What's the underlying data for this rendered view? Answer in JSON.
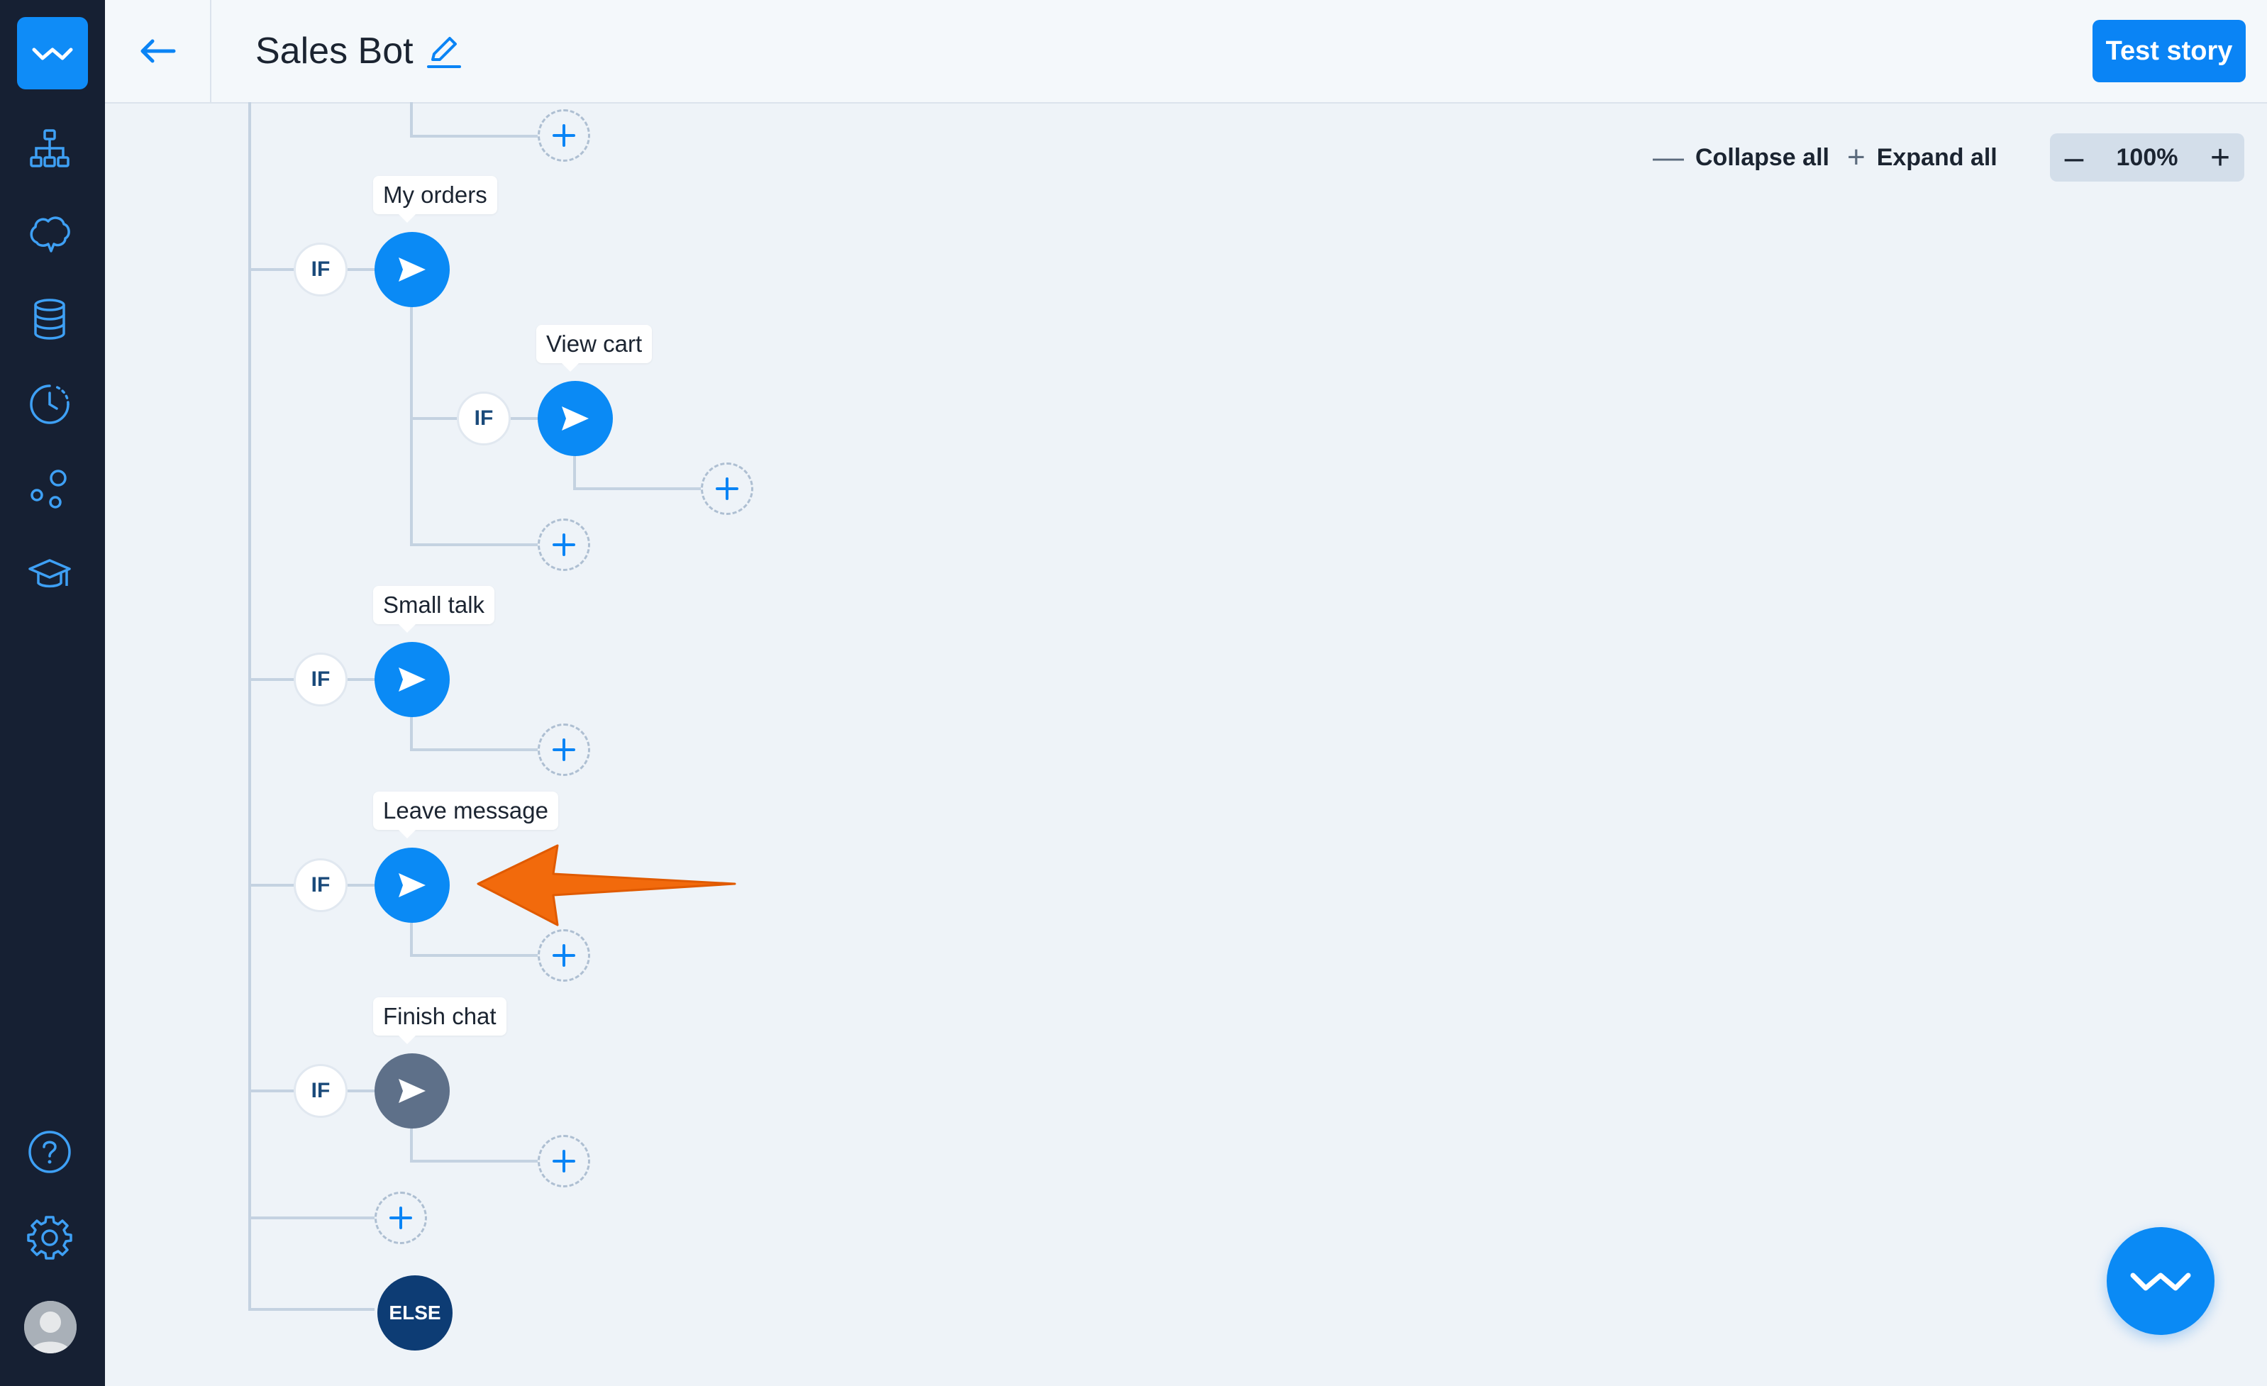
{
  "app": {
    "title": "Sales Bot",
    "test_button": "Test story",
    "accent_color": "#0a84f5"
  },
  "sidebar": {
    "items": [
      {
        "icon": "sitemap-icon"
      },
      {
        "icon": "brain-icon"
      },
      {
        "icon": "database-icon"
      },
      {
        "icon": "history-icon"
      },
      {
        "icon": "integrations-icon"
      },
      {
        "icon": "graduation-cap-icon"
      }
    ],
    "bottom": [
      {
        "icon": "help-icon"
      },
      {
        "icon": "gear-icon"
      },
      {
        "icon": "avatar-icon"
      }
    ]
  },
  "toolbar": {
    "collapse_all": "Collapse all",
    "expand_all": "Expand all",
    "zoom_minus": "–",
    "zoom_value": "100%",
    "zoom_plus": "+"
  },
  "flow": {
    "if_label": "IF",
    "else_label": "ELSE",
    "nodes": [
      {
        "label": "My orders"
      },
      {
        "label": "View cart"
      },
      {
        "label": "Small talk"
      },
      {
        "label": "Leave message"
      },
      {
        "label": "Finish chat"
      }
    ]
  }
}
